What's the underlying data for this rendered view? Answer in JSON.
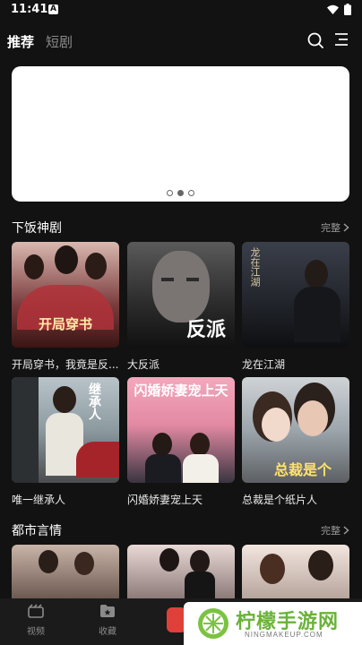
{
  "status_bar": {
    "time": "11:41",
    "notification_letter": "A"
  },
  "header": {
    "tabs": [
      {
        "label": "推荐",
        "active": true
      },
      {
        "label": "短剧",
        "active": false
      }
    ],
    "icons": [
      "search-icon",
      "menu-icon"
    ]
  },
  "banner": {
    "dot_count": 3,
    "active_dot": 1
  },
  "sections": [
    {
      "title": "下饭神剧",
      "more_label": "完整",
      "items": [
        {
          "title": "开局穿书，我竟是反...",
          "poster_text": "开局穿书"
        },
        {
          "title": "大反派",
          "poster_text": "反派"
        },
        {
          "title": "龙在江湖",
          "poster_text": "龙在江湖"
        },
        {
          "title": "唯一继承人",
          "poster_text": "继承人"
        },
        {
          "title": "闪婚娇妻宠上天",
          "poster_text": "闪婚娇妻宠上天"
        },
        {
          "title": "总裁是个纸片人",
          "poster_text": "总裁是个"
        }
      ]
    },
    {
      "title": "都市言情",
      "more_label": "完整",
      "items": []
    }
  ],
  "bottom_nav": [
    {
      "label": "视频",
      "icon": "video-icon"
    },
    {
      "label": "收藏",
      "icon": "favorites-icon"
    }
  ],
  "watermark": {
    "brand": "柠檬手游网",
    "url": "NINGMAKEUP.COM"
  },
  "colors": {
    "background": "#121212",
    "accent": "#ffffff",
    "muted": "#8a8a8a"
  }
}
